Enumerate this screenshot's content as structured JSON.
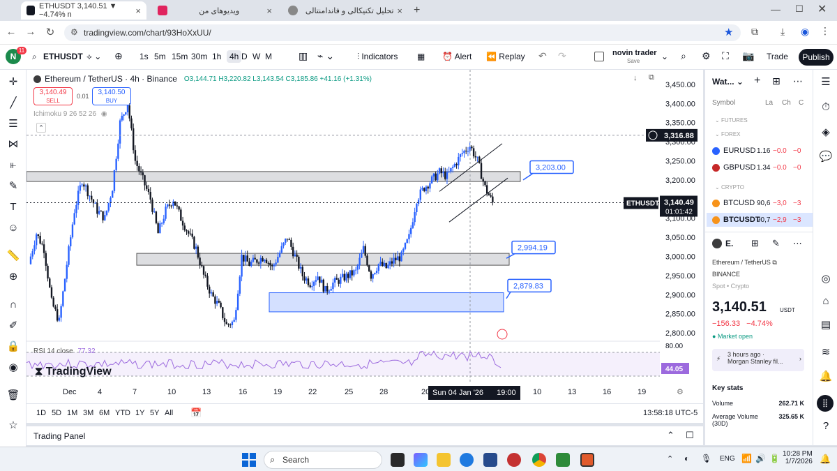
{
  "browser": {
    "tabs": [
      {
        "label": "ETHUSDT 3,140.51 ▼ −4.74% n",
        "active": true
      },
      {
        "label": "ویدیوهای من",
        "active": false
      },
      {
        "label": "تحلیل تکنیکالی و فاندامنتالی",
        "active": false
      }
    ],
    "url": "tradingview.com/chart/93HoXxUU/"
  },
  "tv_header": {
    "avatar_letter": "N",
    "avatar_badge": "11",
    "symbol": "ETHUSDT",
    "intervals": [
      "1s",
      "5m",
      "15m",
      "30m",
      "1h",
      "4h",
      "D",
      "W",
      "M"
    ],
    "active_interval": "4h",
    "indicators_label": "Indicators",
    "alert_label": "Alert",
    "replay_label": "Replay",
    "layout_name": "novin trader",
    "layout_sub": "Save",
    "trade_label": "Trade",
    "publish_label": "Publish"
  },
  "legend": {
    "title": "Ethereum / TetherUS · 4h · Binance",
    "ohlc": "O3,144.71 H3,220.82 L3,143.54 C3,185.86 +41.16 (+1.31%)",
    "sell_price": "3,140.49",
    "sell_label": "SELL",
    "spread": "0.01",
    "buy_price": "3,140.50",
    "buy_label": "BUY",
    "indicator": "Ichimoku 9 26 52 26",
    "rsi_label": "RSI 14 close",
    "rsi_value": "77.32",
    "watermark": "TradingView"
  },
  "chart_data": {
    "type": "candlestick",
    "symbol": "ETHUSDT",
    "ylim": [
      2780,
      3470
    ],
    "y_ticks": [
      "3,450.00",
      "3,400.00",
      "3,350.00",
      "3,300.00",
      "3,250.00",
      "3,200.00",
      "3,150.00",
      "3,100.00",
      "3,050.00",
      "3,000.00",
      "2,950.00",
      "2,900.00",
      "2,850.00",
      "2,800.00"
    ],
    "x_ticks": [
      "Dec",
      "4",
      "7",
      "10",
      "13",
      "16",
      "19",
      "22",
      "25",
      "28",
      "20",
      "10",
      "13",
      "16",
      "19"
    ],
    "crosshair_date": "Sun 04 Jan '26",
    "crosshair_time": "19:00",
    "crosshair_price": "3,316.88",
    "last_price_label": "ETHUSDT",
    "last_price": "3,140.49",
    "countdown": "01:01:42",
    "annotations": [
      {
        "label": "3,203.00",
        "zone": [
          3196,
          3222
        ]
      },
      {
        "label": "2,994.19",
        "zone": [
          2977,
          3008
        ]
      },
      {
        "label": "2,879.83",
        "zone": [
          2855,
          2905
        ]
      }
    ],
    "rsi": {
      "upper": "80.00",
      "current": "44.05"
    },
    "close_path": [
      2980,
      3060,
      3020,
      2880,
      2830,
      2980,
      3120,
      3200,
      3160,
      3120,
      3100,
      3180,
      3350,
      3400,
      3250,
      3200,
      3150,
      3060,
      3120,
      3150,
      3100,
      3060,
      3020,
      2950,
      2900,
      2870,
      2820,
      2830,
      3000,
      2980,
      2990,
      3000,
      2970,
      3010,
      3050,
      3000,
      2950,
      2930,
      2950,
      2910,
      2930,
      2940,
      2950,
      2960,
      3020,
      2950,
      2980,
      2970,
      2990,
      3000,
      3050,
      3150,
      3180,
      3200,
      3220,
      3210,
      3240,
      3270,
      3290,
      3250,
      3180,
      3140
    ]
  },
  "bottom_bar": {
    "ranges": [
      "1D",
      "5D",
      "1M",
      "3M",
      "6M",
      "YTD",
      "1Y",
      "5Y",
      "All"
    ],
    "clock": "13:58:18 UTC-5"
  },
  "trading_panel": {
    "label": "Trading Panel"
  },
  "watchlist": {
    "title": "Wat...",
    "col_symbol": "Symbol",
    "col_last": "La",
    "col_chg": "Ch",
    "col_chgp": "C",
    "section_futures": "FUTURES",
    "section_forex": "FOREX",
    "section_crypto": "CRYPTO",
    "rows": [
      {
        "symbol": "EURUSD",
        "last": "1.16",
        "chg": "−0.0",
        "chgp": "−0",
        "color": "#2962ff"
      },
      {
        "symbol": "GBPUSD",
        "last": "1.34",
        "chg": "−0.0",
        "chgp": "−0",
        "color": "#c62828"
      },
      {
        "symbol": "BTCUSD",
        "last": "90,6",
        "chg": "−3,0",
        "chgp": "−3",
        "color": "#f7931a"
      },
      {
        "symbol": "BTCUSDT",
        "last": "90,7",
        "chg": "−2,9",
        "chgp": "−3",
        "color": "#f7931a"
      }
    ]
  },
  "details": {
    "short": "E.",
    "name": "Ethereum / TetherUS",
    "exchange": "BINANCE",
    "type": "Spot • Crypto",
    "price": "3,140.51",
    "currency": "USDT",
    "change": "−156.33",
    "change_pct": "−4.74%",
    "market_status": "Market open",
    "news_time": "3 hours ago ·",
    "news_text": "Morgan Stanley fil...",
    "key_stats": "Key stats",
    "volume_label": "Volume",
    "volume": "262.71 K",
    "avg_volume_label": "Average Volume",
    "avg_volume_sub": "(30D)",
    "avg_volume": "325.65 K"
  },
  "taskbar": {
    "search": "Search",
    "lang": "ENG",
    "time": "10:28 PM",
    "date": "1/7/2026"
  }
}
